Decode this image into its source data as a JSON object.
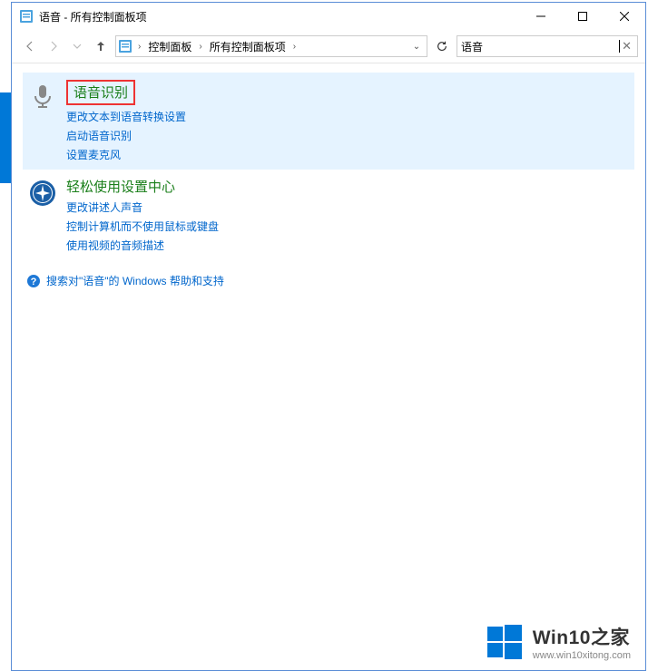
{
  "window": {
    "title": "语音 - 所有控制面板项"
  },
  "nav": {
    "crumb1": "控制面板",
    "crumb2": "所有控制面板项"
  },
  "search": {
    "value": "语音"
  },
  "results": [
    {
      "heading": "语音识别",
      "links": [
        "更改文本到语音转换设置",
        "启动语音识别",
        "设置麦克风"
      ]
    },
    {
      "heading": "轻松使用设置中心",
      "links": [
        "更改讲述人声音",
        "控制计算机而不使用鼠标或键盘",
        "使用视频的音频描述"
      ]
    }
  ],
  "help": {
    "text": "搜索对\"语音\"的 Windows 帮助和支持"
  },
  "watermark": {
    "brand": "Win10之家",
    "url": "www.win10xitong.com"
  }
}
